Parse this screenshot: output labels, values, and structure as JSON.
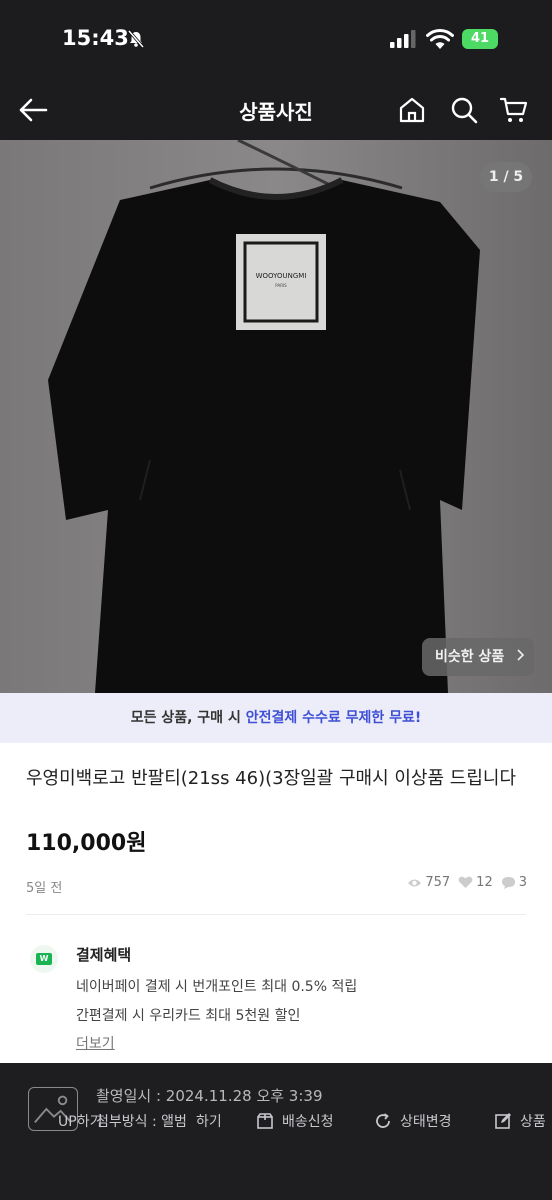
{
  "status_bar": {
    "time": "15:43",
    "battery": "41"
  },
  "header": {
    "title": "상품사진"
  },
  "photo": {
    "counter": "1 / 5",
    "label_brand": "WOOYOUNGMI",
    "label_city": "PARIS",
    "similar_button": "비슷한 상품"
  },
  "promo": {
    "prefix": "모든 상품, 구매 시 ",
    "highlight": "안전결제 수수료 무제한 무료!"
  },
  "product": {
    "title": "우영미백로고 반팔티(21ss  46)(3장일괄 구매시 이상품 드립니다",
    "price": "110,000원",
    "posted": "5일 전",
    "views": "757",
    "likes": "12",
    "chats": "3"
  },
  "benefit": {
    "logo_text": "W",
    "title": "결제혜택",
    "line1": "네이버페이 결제 시 번개포인트 최대 0.5% 적립",
    "line2": "간편결제 시 우리카드 최대 5천원 할인",
    "more": "더보기"
  },
  "bottom_bar": {
    "capture_info": "촬영일시 : 2024.11.28 오후 3:39",
    "actions": [
      "UP하기",
      "첨부방식 : 앨범",
      "하기",
      "배송신청",
      "상태변경",
      "상품"
    ]
  }
}
